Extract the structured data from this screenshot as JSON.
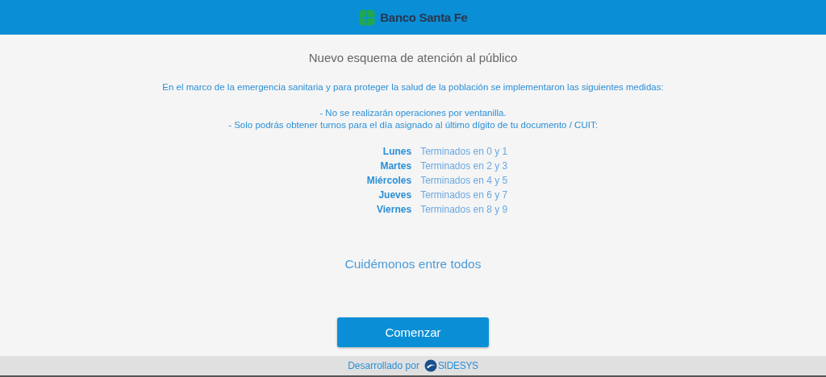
{
  "header": {
    "brand": "Banco Santa Fe"
  },
  "title": "Nuevo esquema de atención al público",
  "intro": "En el marco de la emergencia sanitaria y para proteger la salud de la población se implementaron las siguientes medidas:",
  "measures": [
    "- No se realizarán operaciones por ventanilla.",
    "- Solo podrás obtener turnos para el día asignado al último dígito de tu documento / CUIT:"
  ],
  "schedule": [
    {
      "day": "Lunes",
      "rule": "Terminados en 0 y 1"
    },
    {
      "day": "Martes",
      "rule": "Terminados en 2 y 3"
    },
    {
      "day": "Miércoles",
      "rule": "Terminados en 4 y 5"
    },
    {
      "day": "Jueves",
      "rule": "Terminados en 6 y 7"
    },
    {
      "day": "Viernes",
      "rule": "Terminados en 8 y 9"
    }
  ],
  "closing": "Cuidémonos entre todos",
  "button": "Comenzar",
  "footer": {
    "text": "Desarrollado por",
    "logo": "SIDESYS"
  }
}
